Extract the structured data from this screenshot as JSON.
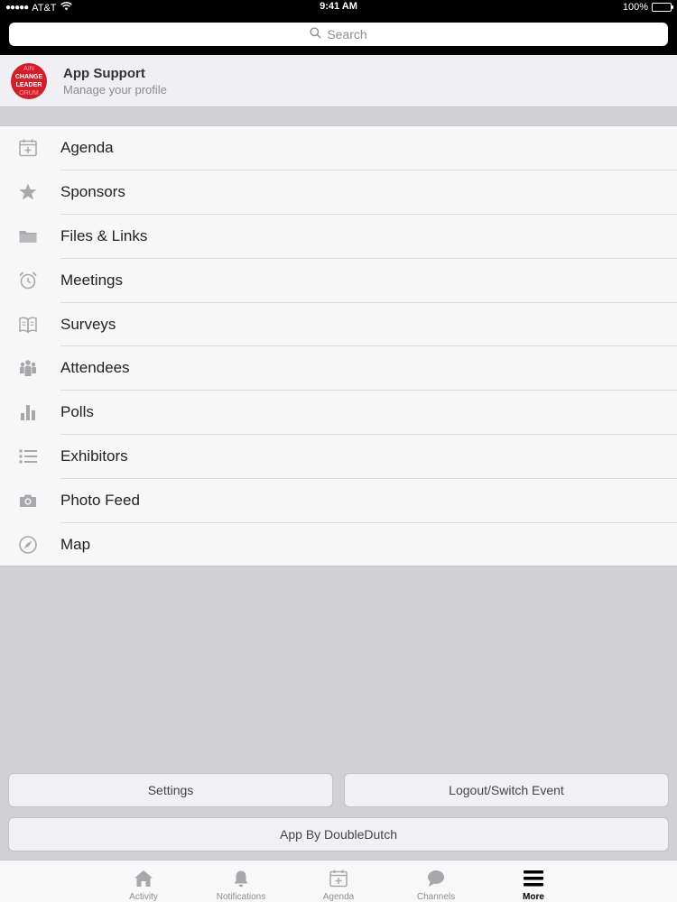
{
  "status_bar": {
    "carrier": "AT&T",
    "time": "9:41 AM",
    "battery": "100%"
  },
  "search": {
    "placeholder": "Search"
  },
  "profile": {
    "name": "App Support",
    "subtitle": "Manage your profile",
    "logo_text": [
      "AIN",
      "CHANGE",
      "LEADER",
      "ORUM"
    ]
  },
  "menu": {
    "items": [
      {
        "label": "Agenda",
        "icon": "calendar-plus-icon"
      },
      {
        "label": "Sponsors",
        "icon": "star-icon"
      },
      {
        "label": "Files & Links",
        "icon": "folder-icon"
      },
      {
        "label": "Meetings",
        "icon": "alarm-clock-icon"
      },
      {
        "label": "Surveys",
        "icon": "open-book-icon"
      },
      {
        "label": "Attendees",
        "icon": "people-icon"
      },
      {
        "label": "Polls",
        "icon": "bar-chart-icon"
      },
      {
        "label": "Exhibitors",
        "icon": "list-icon"
      },
      {
        "label": "Photo Feed",
        "icon": "camera-icon"
      },
      {
        "label": "Map",
        "icon": "compass-icon"
      }
    ]
  },
  "buttons": {
    "settings": "Settings",
    "logout": "Logout/Switch Event",
    "app_by": "App By DoubleDutch"
  },
  "tabbar": {
    "active": "More",
    "tabs": [
      {
        "label": "Activity",
        "icon": "home-icon"
      },
      {
        "label": "Notifications",
        "icon": "bell-icon"
      },
      {
        "label": "Agenda",
        "icon": "calendar-plus-icon"
      },
      {
        "label": "Channels",
        "icon": "chat-bubble-icon"
      },
      {
        "label": "More",
        "icon": "hamburger-menu-icon"
      }
    ]
  },
  "colors": {
    "icon_gray": "#a7a7ac",
    "logo_red": "#d11f2b",
    "background": "#d1d1d4"
  }
}
